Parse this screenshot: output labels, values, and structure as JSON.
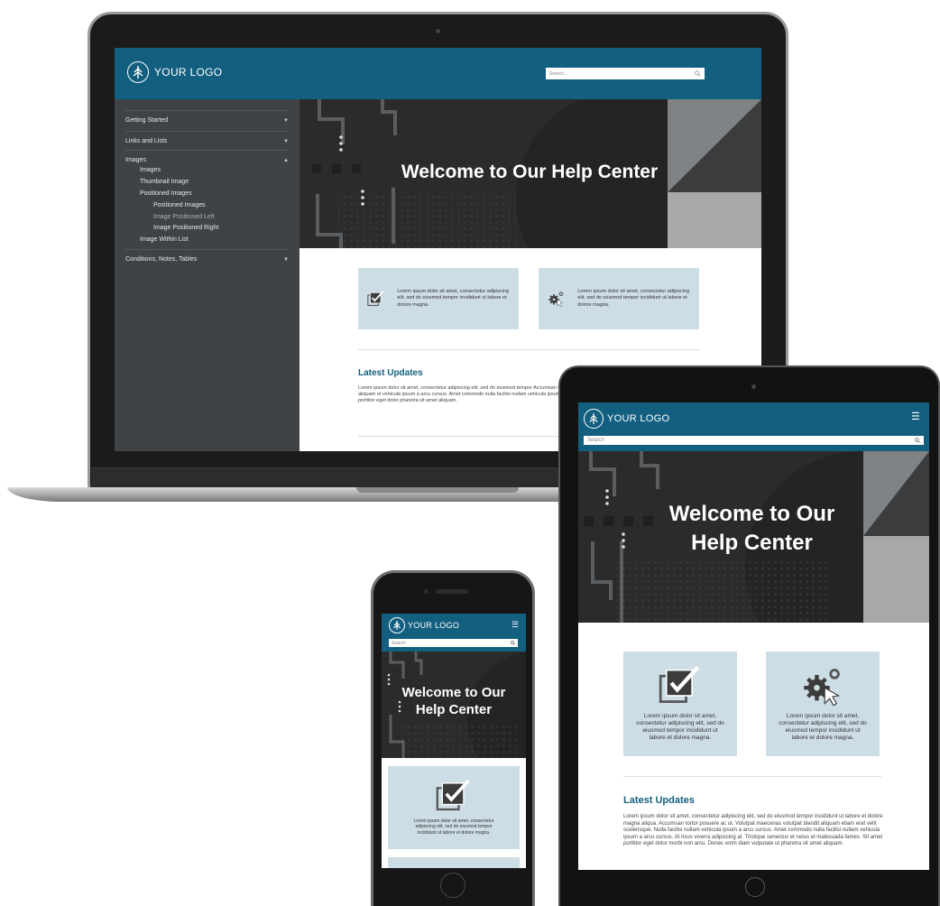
{
  "brand": {
    "logo_text": "YOUR LOGO",
    "primary": "#135f7f",
    "tile_bg": "#cddde6",
    "hero_bg": "#2b2b2b",
    "sidebar_bg": "#3f4346"
  },
  "search": {
    "laptop_placeholder": "Search...",
    "placeholder": "Search"
  },
  "hero": {
    "title": "Welcome to Our Help Center",
    "title_line1": "Welcome to Our",
    "title_line2": "Help Center"
  },
  "tiles": {
    "text": "Lorem ipsum dolor sit amet, consectetur adipiscing elit, sed do eiusmod tempor incididunt ut labore et dolore magna.",
    "icons": [
      "checkbox-icon",
      "gears-cursor-icon"
    ]
  },
  "updates": {
    "title": "Latest Updates",
    "laptop_text": "Lorem ipsum dolor sit amet, consectetur adipiscing elit, sed do eiusmod tempor Accumsan tortor posuere ac ut. Volutpat maecenas volutpat blandit aliquam et vehicula ipsum a arcu cursus. Amet commodo nulla facilisi nullam vehicula ipsum Tristique senectus et netus et malesuada fames. Sit amet porttitor eget dolor pharetra sit amet aliquam.",
    "tablet_text": "Lorem ipsum dolor sit amet, consectetur adipiscing elit, sed do eiusmod tempor incididunt ut labore et dolore magna aliqua. Accumsan tortor posuere ac ut. Volutpat maecenas volutpat blandit aliquam etiam erat velit scelerisque. Nulla facilisi nullam vehicula ipsum a arcu cursus. Amet commodo nulla facilisi nullam vehicula ipsum a arcu cursus. At risus viverra adipiscing at. Tristique senectus et netus et malesuada fames. Sit amet porttitor eget dolor morbi non arcu. Donec enim diam vulputate ut pharetra sit amet aliquam."
  },
  "sidebar": {
    "items": [
      {
        "label": "Getting Started",
        "chevron": "chevron-down-icon"
      },
      {
        "label": "Links and Lists",
        "chevron": "chevron-down-icon"
      },
      {
        "label": "Images",
        "chevron": "chevron-up-icon"
      },
      {
        "label": "Conditions, Notes, Tables",
        "chevron": "chevron-down-icon"
      }
    ],
    "images_children": [
      {
        "label": "Images",
        "level": 1
      },
      {
        "label": "Thumbnail Image",
        "level": 1
      },
      {
        "label": "Positioned Images",
        "level": 1
      },
      {
        "label": "Positioned Images",
        "level": 2
      },
      {
        "label": "Image Positioned Left",
        "level": 2,
        "active": true
      },
      {
        "label": "Image Positioned Right",
        "level": 2
      },
      {
        "label": "Image Within List",
        "level": 1
      }
    ]
  }
}
